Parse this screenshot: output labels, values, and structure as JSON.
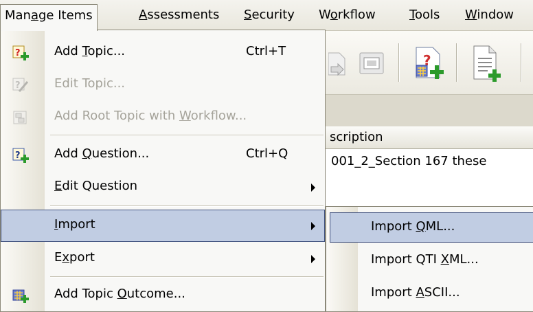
{
  "menubar": {
    "items": [
      {
        "pre": "Man",
        "u": "a",
        "post": "ge Items"
      },
      {
        "pre": "",
        "u": "A",
        "post": "ssessments"
      },
      {
        "pre": "",
        "u": "S",
        "post": "ecurity"
      },
      {
        "pre": "W",
        "u": "o",
        "post": "rkflow"
      },
      {
        "pre": "",
        "u": "T",
        "post": "ools"
      },
      {
        "pre": "",
        "u": "W",
        "post": "indow"
      }
    ]
  },
  "background": {
    "column_header": "scription",
    "row_text": "001_2_Section 167 these"
  },
  "menu": {
    "items": [
      {
        "pre": "Add ",
        "u": "T",
        "post": "opic...",
        "shortcut": "Ctrl+T",
        "icon": "add-topic-icon",
        "disabled": false
      },
      {
        "pre": "Edit Topic...",
        "u": "",
        "post": "",
        "shortcut": "",
        "icon": "edit-topic-icon",
        "disabled": true
      },
      {
        "pre": "Add Root Topic with ",
        "u": "W",
        "post": "orkflow...",
        "shortcut": "",
        "icon": "add-root-topic-icon",
        "disabled": true
      },
      {
        "pre": "Add ",
        "u": "Q",
        "post": "uestion...",
        "shortcut": "Ctrl+Q",
        "icon": "add-question-icon",
        "disabled": false
      },
      {
        "pre": "",
        "u": "E",
        "post": "dit Question",
        "shortcut": "",
        "icon": "",
        "disabled": false,
        "submenu": true
      },
      {
        "pre": "",
        "u": "I",
        "post": "mport",
        "shortcut": "",
        "icon": "",
        "disabled": false,
        "submenu": true,
        "highlighted": true
      },
      {
        "pre": "E",
        "u": "x",
        "post": "port",
        "shortcut": "",
        "icon": "",
        "disabled": false,
        "submenu": true
      },
      {
        "pre": "Add Topic ",
        "u": "O",
        "post": "utcome...",
        "shortcut": "",
        "icon": "add-topic-outcome-icon",
        "disabled": false
      }
    ]
  },
  "submenu": {
    "items": [
      {
        "pre": "Import ",
        "u": "Q",
        "post": "ML...",
        "highlighted": true
      },
      {
        "pre": "Import QTI ",
        "u": "X",
        "post": "ML..."
      },
      {
        "pre": "Import ",
        "u": "A",
        "post": "SCII..."
      }
    ]
  },
  "colors": {
    "highlight_bg": "#c1cde3",
    "highlight_border": "#3e4f7c",
    "menu_bg": "#f8f8f6",
    "disabled_text": "#a5a39a"
  }
}
